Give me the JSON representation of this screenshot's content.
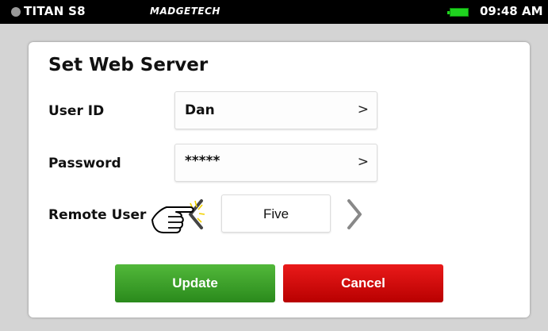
{
  "status_bar": {
    "device_name": "TITAN S8",
    "brand": "MADGETECH",
    "time": "09:48 AM",
    "battery_color": "#1fd41f"
  },
  "dialog": {
    "title": "Set Web Server",
    "user_id": {
      "label": "User ID",
      "value": "Dan",
      "chevron": ">"
    },
    "password": {
      "label": "Password",
      "value": "*****",
      "chevron": ">"
    },
    "remote_user": {
      "label": "Remote User",
      "value": "Five"
    },
    "update_label": "Update",
    "cancel_label": "Cancel"
  },
  "colors": {
    "update": "#3a9e28",
    "cancel": "#d60a0a"
  },
  "icons": [
    "chevron-left-icon",
    "chevron-right-icon",
    "pointing-hand-icon"
  ]
}
